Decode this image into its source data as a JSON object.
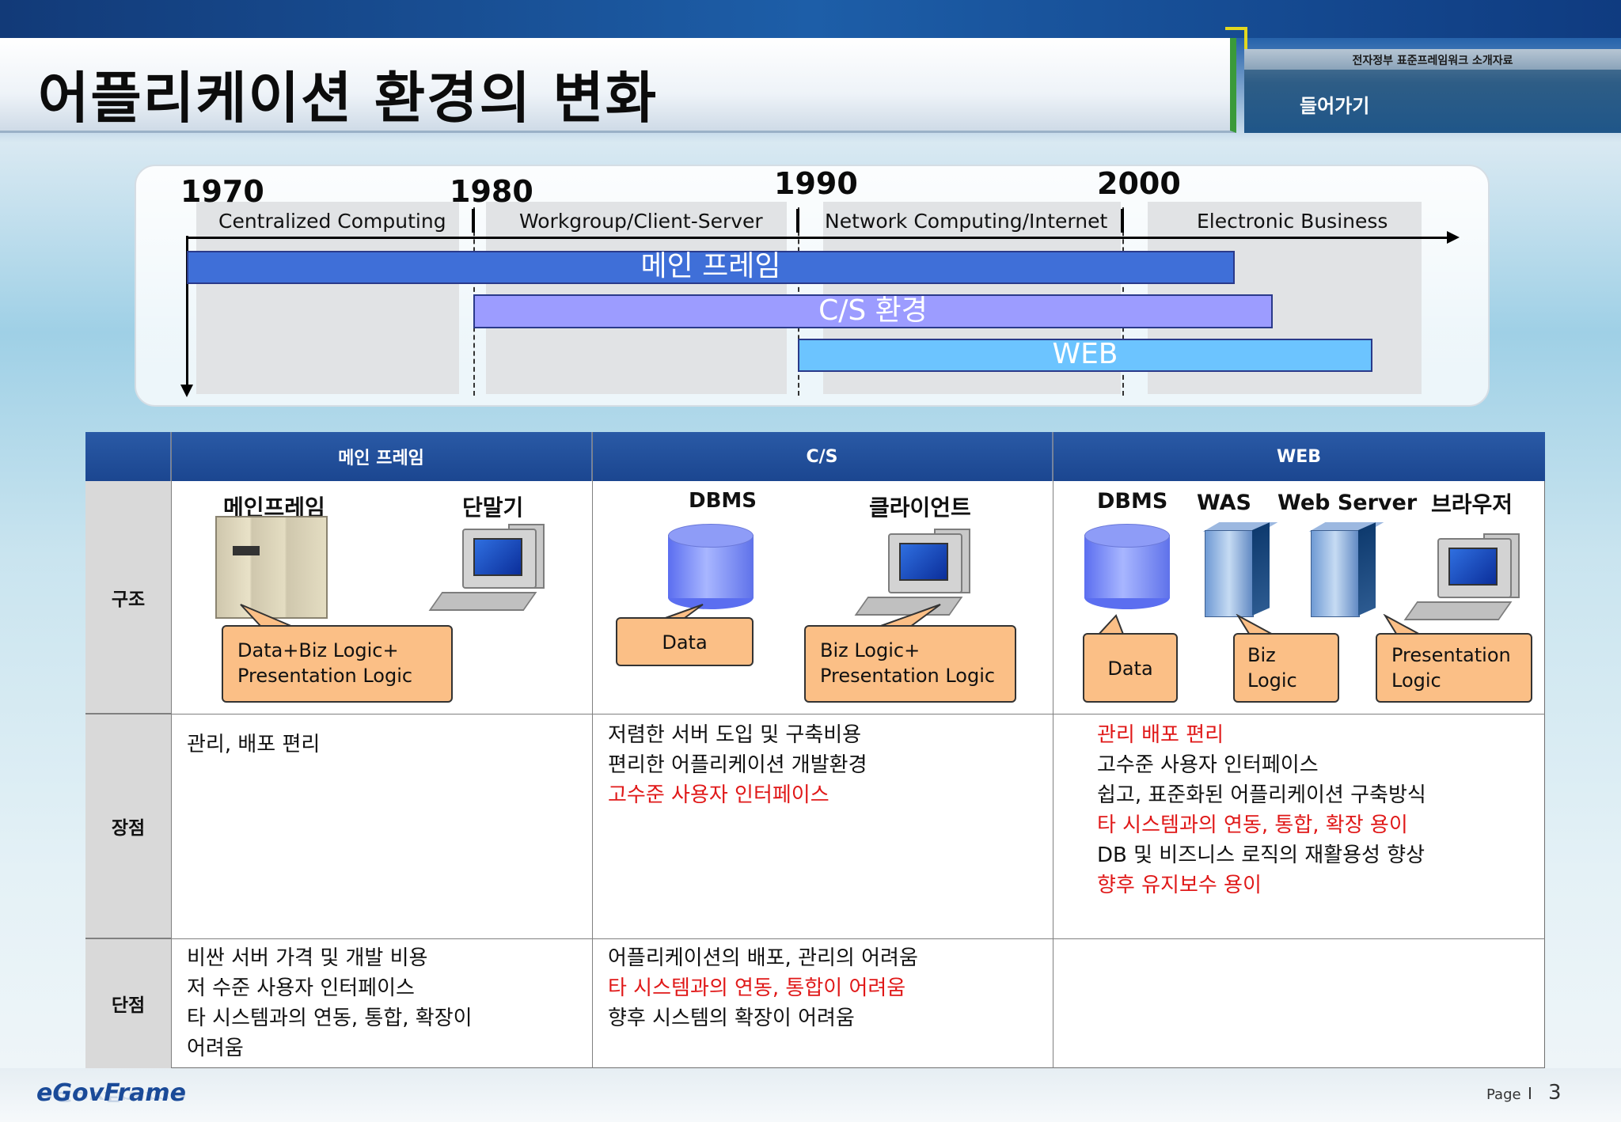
{
  "header": {
    "title": "어플리케이션 환경의 변화",
    "doc_label": "전자정부 표준프레임워크 소개자료",
    "nav_enter": "들어가기"
  },
  "timeline": {
    "years": [
      "1970",
      "1980",
      "1990",
      "2000"
    ],
    "eras": [
      "Centralized Computing",
      "Workgroup/Client-Server",
      "Network Computing/Internet",
      "Electronic Business"
    ],
    "bars": {
      "mainframe": "메인 프레임",
      "cs": "C/S 환경",
      "web": "WEB"
    }
  },
  "table": {
    "headers": [
      "메인 프레임",
      "C/S",
      "WEB"
    ],
    "row_labels": [
      "구조",
      "장점",
      "단점"
    ],
    "structure": {
      "mainframe": {
        "label_server": "메인프레임",
        "label_terminal": "단말기",
        "callout": [
          "Data+Biz Logic+",
          "Presentation Logic"
        ]
      },
      "cs": {
        "label_db": "DBMS",
        "label_client": "클라이언트",
        "callout_db": "Data",
        "callout_client": [
          "Biz Logic+",
          "Presentation Logic"
        ]
      },
      "web": {
        "label_db": "DBMS",
        "label_was": "WAS",
        "label_webserver": "Web Server",
        "label_browser": "브라우저",
        "callout_db": "Data",
        "callout_was": [
          "Biz",
          "Logic"
        ],
        "callout_browser": [
          "Presentation",
          "Logic"
        ]
      }
    },
    "pros": {
      "mainframe": [
        {
          "text": "관리, 배포 편리",
          "red": false
        }
      ],
      "cs": [
        {
          "text": "저렴한 서버 도입 및 구축비용",
          "red": false
        },
        {
          "text": "편리한 어플리케이션 개발환경",
          "red": false
        },
        {
          "text": "고수준 사용자 인터페이스",
          "red": true
        }
      ],
      "web": [
        {
          "text": "관리 배포 편리",
          "red": true
        },
        {
          "text": "고수준 사용자 인터페이스",
          "red": false
        },
        {
          "text": "쉽고, 표준화된 어플리케이션 구축방식",
          "red": false
        },
        {
          "text": "타 시스템과의 연동, 통합, 확장 용이",
          "red": true
        },
        {
          "text": "DB 및 비즈니스 로직의 재활용성 향상",
          "red": false
        },
        {
          "text": "향후 유지보수 용이",
          "red": true
        }
      ]
    },
    "cons": {
      "mainframe": [
        {
          "text": "비싼 서버 가격 및 개발 비용",
          "red": false
        },
        {
          "text": "저 수준 사용자 인터페이스",
          "red": false
        },
        {
          "text": "타 시스템과의 연동, 통합, 확장이",
          "red": false
        },
        {
          "text": "어려움",
          "red": false
        }
      ],
      "cs": [
        {
          "text": "어플리케이션의 배포, 관리의 어려움",
          "red": false
        },
        {
          "text": "타 시스템과의 연동, 통합이 어려움",
          "red": true
        },
        {
          "text": "향후 시스템의 확장이 어려움",
          "red": false
        }
      ],
      "web": []
    }
  },
  "footer": {
    "logo": "eGovFrame",
    "page_label": "Page",
    "page_sep": "I",
    "page_number": "3"
  },
  "colors": {
    "header_blue": "#1b4690",
    "bar_mainframe": "#3f6fd8",
    "bar_cs": "#9c9cff",
    "bar_web": "#6cc4ff",
    "callout": "#fbbf86",
    "emphasis_red": "#e01818"
  }
}
